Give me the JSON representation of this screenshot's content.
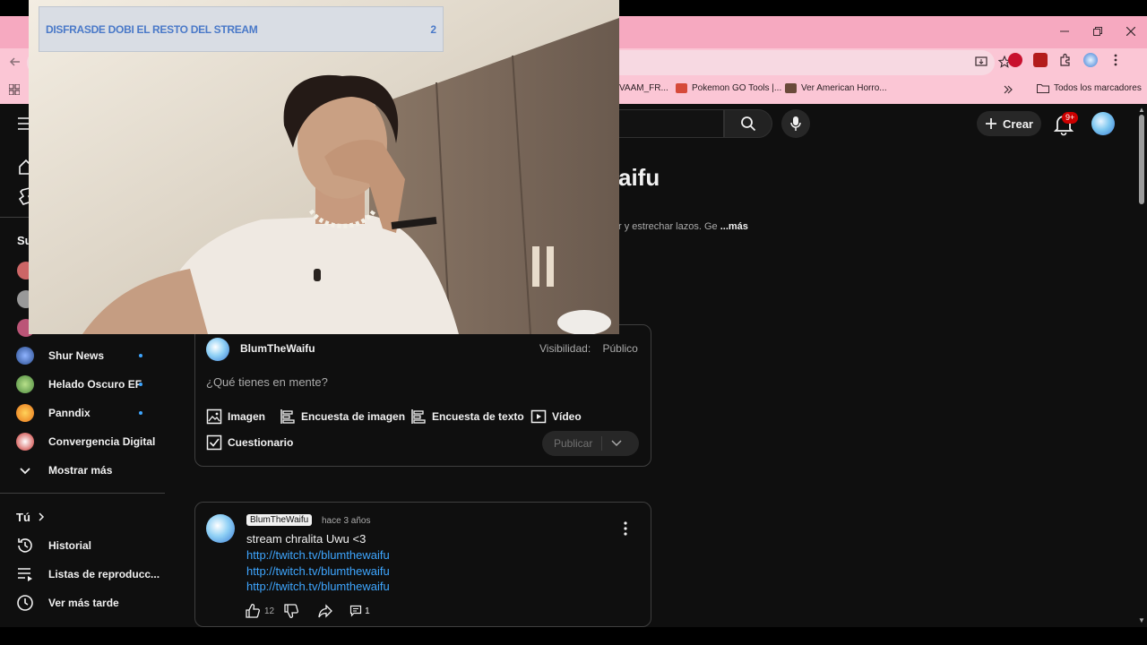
{
  "overlay": {
    "banner_text": "DISFRASDE DOBI EL RESTO DEL STREAM",
    "banner_count": "2"
  },
  "browser": {
    "bookmarks": [
      {
        "label": "VAAM_FR...",
        "icon": "bookmark-icon"
      },
      {
        "label": "Pokemon GO Tools |...",
        "icon": "pokemon-icon"
      },
      {
        "label": "Ver American Horro...",
        "icon": "film-icon"
      }
    ],
    "all_bookmarks_label": "Todos los marcadores",
    "notification_badge": "9+"
  },
  "header": {
    "create_label": "Crear"
  },
  "sidebar": {
    "subs_heading_partial": "Su",
    "channels": [
      {
        "name": "Shur News",
        "color": "#2a4d8f"
      },
      {
        "name": "Helado Oscuro EF",
        "color": "#4c8a3f"
      },
      {
        "name": "Panndix",
        "color": "#e8731a"
      },
      {
        "name": "Convergencia Digital",
        "color": "#c9302c"
      }
    ],
    "show_more_label": "Mostrar más",
    "you_label": "Tú",
    "you_items": [
      {
        "label": "Historial",
        "icon": "history-icon"
      },
      {
        "label": "Listas de reproducc...",
        "icon": "playlist-icon"
      },
      {
        "label": "Ver más tarde",
        "icon": "clock-icon"
      }
    ]
  },
  "channel": {
    "title_partial": "aifu",
    "desc_partial": "r y estrechar lazos. Ge",
    "more_label": "...más"
  },
  "composer": {
    "username": "BlumTheWaifu",
    "visibility_label": "Visibilidad:",
    "visibility_value": "Público",
    "placeholder": "¿Qué tienes en mente?",
    "tools": {
      "image": "Imagen",
      "image_poll": "Encuesta de imagen",
      "text_poll": "Encuesta de texto",
      "video": "Vídeo",
      "quiz": "Cuestionario"
    },
    "publish_label": "Publicar"
  },
  "post": {
    "author": "BlumTheWaifu",
    "time": "hace 3 años",
    "text": "stream  chralita Uwu <3",
    "links": [
      "http://twitch.tv/blumthewaifu",
      "http://twitch.tv/blumthewaifu",
      "http://twitch.tv/blumthewaifu"
    ],
    "likes": "12",
    "comments": "1"
  }
}
